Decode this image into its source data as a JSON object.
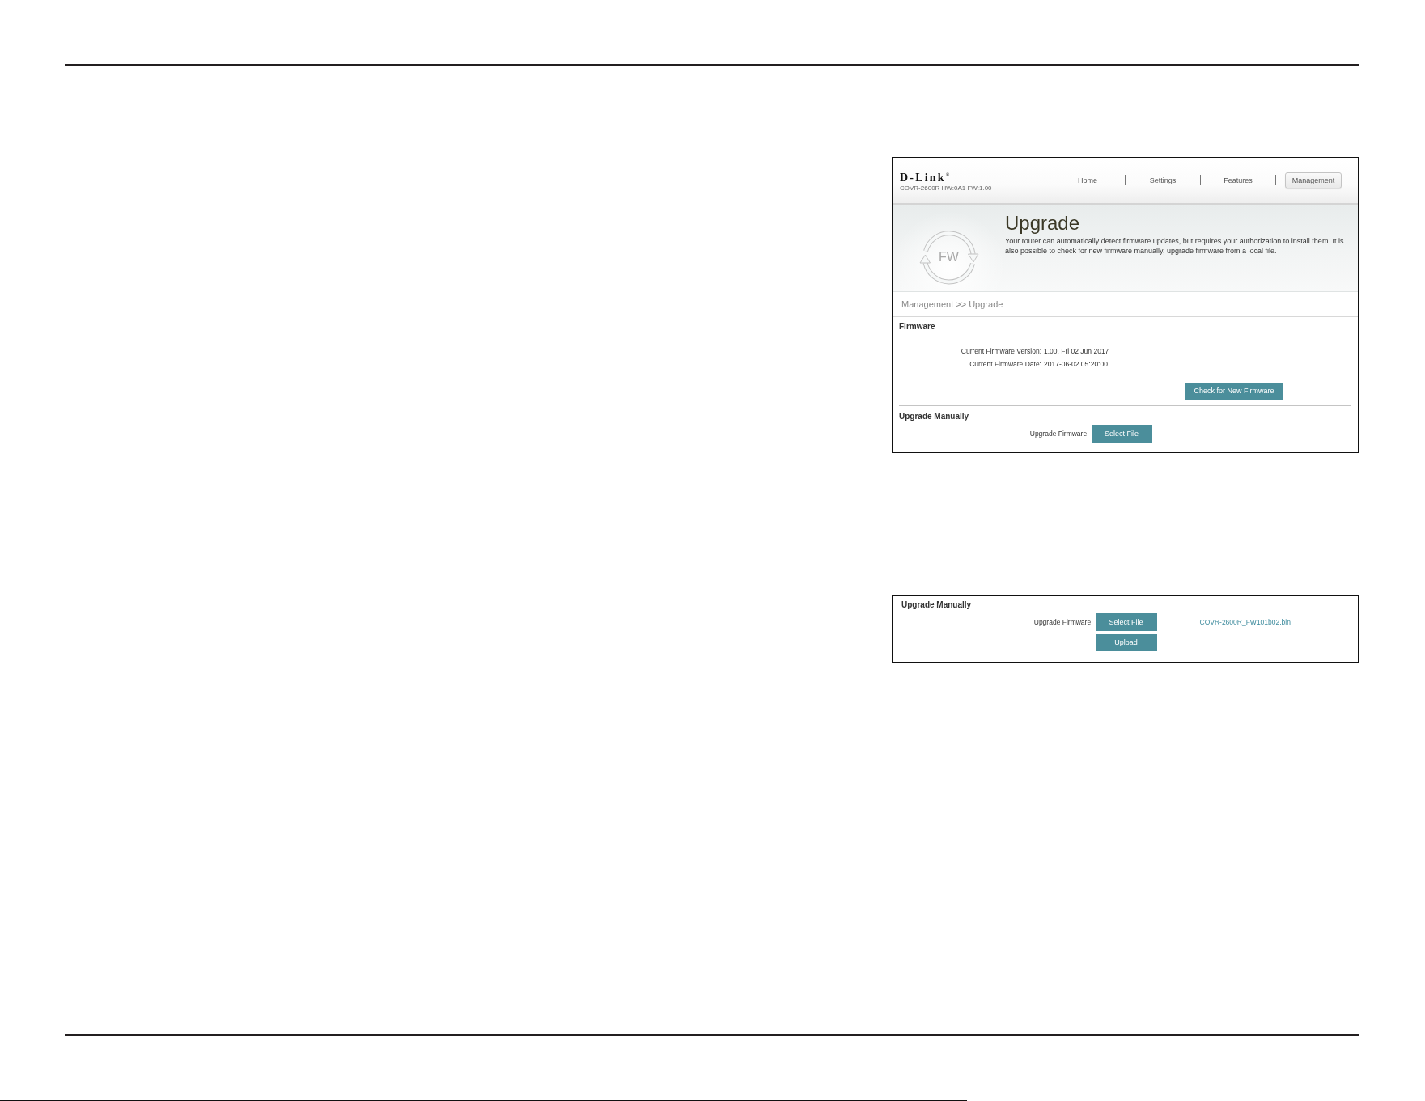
{
  "screenshot_upgrade": {
    "header": {
      "logo": "D-Link$^{®}$",
      "model_info": "COVR-2600R HW:0A1 FW:1.00",
      "nav": [
        {
          "label": "Home",
          "selected": false
        },
        {
          "label": "Settings",
          "selected": false
        },
        {
          "label": "Features",
          "selected": false
        },
        {
          "label": "Management",
          "selected": true
        }
      ]
    },
    "banner": {
      "icon_label": "FW",
      "title": "Upgrade",
      "description": "Your router can automatically detect firmware updates, but requires your authorization to install them. It is also possible to check for new firmware manually, upgrade firmware from a local file."
    },
    "breadcrumb": "Management >> Upgrade",
    "firmware_section": {
      "title": "Firmware",
      "fields": [
        {
          "label": "Current Firmware Version:",
          "value": "1.00, Fri 02 Jun 2017"
        },
        {
          "label": "Current Firmware Date:",
          "value": "2017-06-02 05:20:00"
        }
      ],
      "button": "Check for New Firmware"
    },
    "upgrade_section": {
      "title": "Upgrade Manually",
      "label": "Upgrade Firmware:",
      "button": "Select File"
    }
  },
  "screenshot_upload": {
    "title": "Upgrade Manually",
    "label": "Upgrade Firmware:",
    "select_button": "Select File",
    "file_name": "COVR-2600R_FW101b02.bin",
    "upload_button": "Upload"
  }
}
